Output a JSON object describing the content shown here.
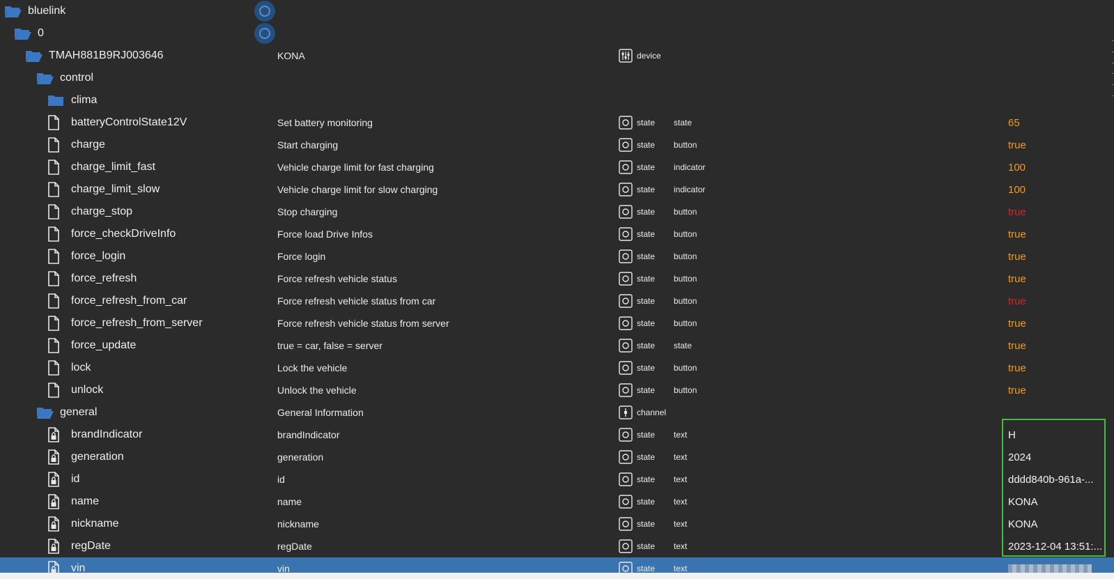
{
  "rows": [
    {
      "name": "bluelink",
      "icon": "folder-open",
      "indent": 0,
      "desc": "",
      "type": "",
      "type_icon": "",
      "role": "",
      "value": "",
      "value_color": "",
      "dot": true
    },
    {
      "name": "0",
      "icon": "folder-open",
      "indent": 1,
      "desc": "",
      "type": "",
      "type_icon": "",
      "role": "",
      "value": "",
      "value_color": "",
      "dot": true
    },
    {
      "name": "TMAH881B9RJ003646",
      "icon": "folder-open",
      "indent": 2,
      "desc": "KONA",
      "type": "device",
      "type_icon": "device",
      "role": "",
      "value": "",
      "value_color": ""
    },
    {
      "name": "control",
      "icon": "folder-open",
      "indent": 3,
      "desc": "",
      "type": "",
      "type_icon": "",
      "role": "",
      "value": "",
      "value_color": ""
    },
    {
      "name": "clima",
      "icon": "folder-closed",
      "indent": 4,
      "desc": "",
      "type": "",
      "type_icon": "",
      "role": "",
      "value": "",
      "value_color": ""
    },
    {
      "name": "batteryControlState12V",
      "icon": "file",
      "indent": 4,
      "desc": "Set battery monitoring",
      "type": "state",
      "type_icon": "state",
      "role": "state",
      "value": "65",
      "value_color": "orange"
    },
    {
      "name": "charge",
      "icon": "file",
      "indent": 4,
      "desc": "Start charging",
      "type": "state",
      "type_icon": "state",
      "role": "button",
      "value": "true",
      "value_color": "orange"
    },
    {
      "name": "charge_limit_fast",
      "icon": "file",
      "indent": 4,
      "desc": "Vehicle charge limit for fast charging",
      "type": "state",
      "type_icon": "state",
      "role": "indicator",
      "value": "100",
      "value_color": "orange"
    },
    {
      "name": "charge_limit_slow",
      "icon": "file",
      "indent": 4,
      "desc": "Vehicle charge limit for slow charging",
      "type": "state",
      "type_icon": "state",
      "role": "indicator",
      "value": "100",
      "value_color": "orange"
    },
    {
      "name": "charge_stop",
      "icon": "file",
      "indent": 4,
      "desc": "Stop charging",
      "type": "state",
      "type_icon": "state",
      "role": "button",
      "value": "true",
      "value_color": "red"
    },
    {
      "name": "force_checkDriveInfo",
      "icon": "file",
      "indent": 4,
      "desc": "Force load Drive Infos",
      "type": "state",
      "type_icon": "state",
      "role": "button",
      "value": "true",
      "value_color": "orange"
    },
    {
      "name": "force_login",
      "icon": "file",
      "indent": 4,
      "desc": "Force login",
      "type": "state",
      "type_icon": "state",
      "role": "button",
      "value": "true",
      "value_color": "orange"
    },
    {
      "name": "force_refresh",
      "icon": "file",
      "indent": 4,
      "desc": "Force refresh vehicle status",
      "type": "state",
      "type_icon": "state",
      "role": "button",
      "value": "true",
      "value_color": "orange"
    },
    {
      "name": "force_refresh_from_car",
      "icon": "file",
      "indent": 4,
      "desc": "Force refresh vehicle status from car",
      "type": "state",
      "type_icon": "state",
      "role": "button",
      "value": "true",
      "value_color": "red"
    },
    {
      "name": "force_refresh_from_server",
      "icon": "file",
      "indent": 4,
      "desc": "Force refresh vehicle status from server",
      "type": "state",
      "type_icon": "state",
      "role": "button",
      "value": "true",
      "value_color": "orange"
    },
    {
      "name": "force_update",
      "icon": "file",
      "indent": 4,
      "desc": "true = car, false = server",
      "type": "state",
      "type_icon": "state",
      "role": "state",
      "value": "true",
      "value_color": "orange"
    },
    {
      "name": "lock",
      "icon": "file",
      "indent": 4,
      "desc": "Lock the vehicle",
      "type": "state",
      "type_icon": "state",
      "role": "button",
      "value": "true",
      "value_color": "orange"
    },
    {
      "name": "unlock",
      "icon": "file",
      "indent": 4,
      "desc": "Unlock the vehicle",
      "type": "state",
      "type_icon": "state",
      "role": "button",
      "value": "true",
      "value_color": "orange"
    },
    {
      "name": "general",
      "icon": "folder-open",
      "indent": 3,
      "desc": "General Information",
      "type": "channel",
      "type_icon": "channel",
      "role": "",
      "value": "",
      "value_color": ""
    },
    {
      "name": "brandIndicator",
      "icon": "file-lock",
      "indent": 4,
      "desc": "brandIndicator",
      "type": "state",
      "type_icon": "state",
      "role": "text",
      "value": "H",
      "value_color": "white"
    },
    {
      "name": "generation",
      "icon": "file-lock",
      "indent": 4,
      "desc": "generation",
      "type": "state",
      "type_icon": "state",
      "role": "text",
      "value": "2024",
      "value_color": "white"
    },
    {
      "name": "id",
      "icon": "file-lock",
      "indent": 4,
      "desc": "id",
      "type": "state",
      "type_icon": "state",
      "role": "text",
      "value": "dddd840b-961a-...",
      "value_color": "white"
    },
    {
      "name": "name",
      "icon": "file-lock",
      "indent": 4,
      "desc": "name",
      "type": "state",
      "type_icon": "state",
      "role": "text",
      "value": "KONA",
      "value_color": "white"
    },
    {
      "name": "nickname",
      "icon": "file-lock",
      "indent": 4,
      "desc": "nickname",
      "type": "state",
      "type_icon": "state",
      "role": "text",
      "value": "KONA",
      "value_color": "white"
    },
    {
      "name": "regDate",
      "icon": "file-lock",
      "indent": 4,
      "desc": "regDate",
      "type": "state",
      "type_icon": "state",
      "role": "text",
      "value": "2023-12-04 13:51:...",
      "value_color": "white"
    },
    {
      "name": "vin",
      "icon": "file-lock",
      "indent": 4,
      "desc": "vin",
      "type": "state",
      "type_icon": "state",
      "role": "text",
      "value": "",
      "value_color": "white",
      "selected": true,
      "blurred": true
    }
  ],
  "colors": {
    "orange": "#f39b1a",
    "red": "#d0262a",
    "white": "#f3f3f3",
    "folder": "#3b78c4",
    "highlight": "#3fc23f",
    "selected": "#3a74b0"
  }
}
